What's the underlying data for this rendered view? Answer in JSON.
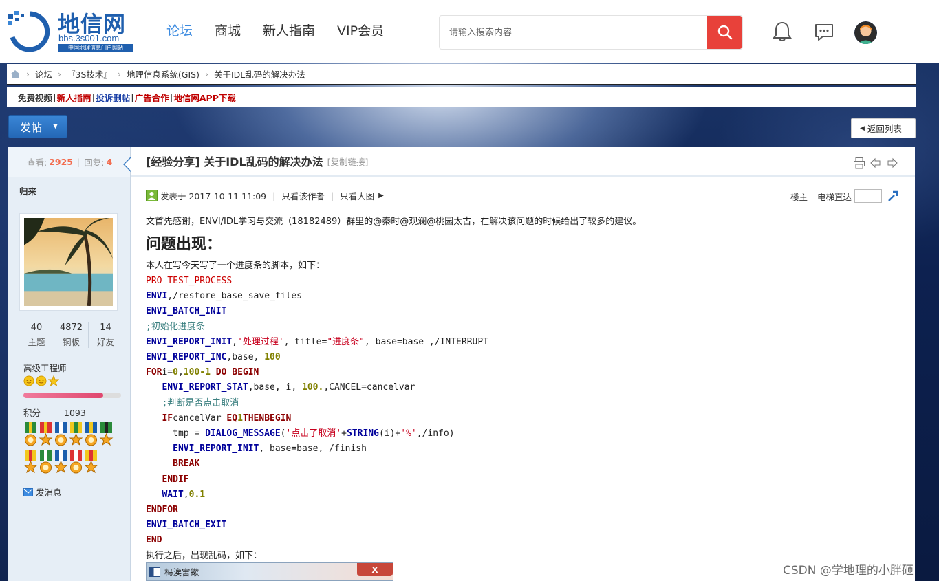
{
  "header": {
    "logo_title": "地信网",
    "logo_url": "bbs.3s001.com",
    "logo_sub": "中国地理信息门户网站",
    "nav": [
      "论坛",
      "商城",
      "新人指南",
      "VIP会员"
    ],
    "active_nav": "论坛",
    "search_placeholder": "请输入搜索内容"
  },
  "breadcrumb": [
    "论坛",
    "『3S技术』",
    "地理信息系统(GIS)",
    "关于IDL乱码的解决办法"
  ],
  "sub_links": [
    {
      "label": "免费视频",
      "color": "#333333"
    },
    {
      "label": "新人指南",
      "color": "#c00000"
    },
    {
      "label": "投诉删帖",
      "color": "#1a3fa6"
    },
    {
      "label": "广告合作",
      "color": "#c00000"
    },
    {
      "label": "地信网APP下载",
      "color": "#c00000"
    }
  ],
  "post_button": "发帖",
  "back_button": "返回列表",
  "sidebar": {
    "views_label": "查看:",
    "views": "2925",
    "replies_label": "回复:",
    "replies": "4",
    "username": "归来",
    "counts": [
      {
        "value": "40",
        "label": "主题"
      },
      {
        "value": "4872",
        "label": "铜板"
      },
      {
        "value": "14",
        "label": "好友"
      }
    ],
    "rank": "高级工程师",
    "level_progress": 0.82,
    "points_label": "积分",
    "points": "1093",
    "send_message": "发消息"
  },
  "post": {
    "category": "[经验分享]",
    "title": "关于IDL乱码的解决办法",
    "copy_link": "[复制链接]",
    "posted_at": "发表于 2017-10-11 11:09",
    "only_author": "只看该作者",
    "large_image": "只看大图",
    "floor": "楼主",
    "elevator": "电梯直达",
    "intro": "文首先感谢，ENVI/IDL学习与交流（18182489）群里的@秦时@观澜@桃园太古，在解决该问题的时候给出了较多的建议。",
    "heading": "问题出现：",
    "para1": "本人在写今天写了一个进度条的脚本，如下：",
    "para2": "执行之后，出现乱码，如下：",
    "error_window_title": "杩涘害鏉",
    "error_close": "X"
  },
  "code_lines": [
    [
      [
        "red",
        "PRO TEST_PROCESS"
      ]
    ],
    [
      [
        "kw",
        "ENVI"
      ],
      [
        "plain",
        ",/restore_base_save_files"
      ]
    ],
    [
      [
        "kw",
        "ENVI_BATCH_INIT"
      ]
    ],
    [
      [
        "cmt",
        ";初始化进度条"
      ]
    ],
    [
      [
        "kw",
        "ENVI_REPORT_INIT"
      ],
      [
        "plain",
        ","
      ],
      [
        "str",
        "'处理过程'"
      ],
      [
        "plain",
        ", title="
      ],
      [
        "str",
        "\"进度条\""
      ],
      [
        "plain",
        ", base=base ,/INTERRUPT"
      ]
    ],
    [
      [
        "kw",
        "ENVI_REPORT_INC"
      ],
      [
        "plain",
        ",base, "
      ],
      [
        "num",
        "100"
      ]
    ],
    [
      [
        "kwr",
        "FOR"
      ],
      [
        "plain",
        "i="
      ],
      [
        "num",
        "0"
      ],
      [
        "plain",
        ","
      ],
      [
        "num",
        "100-1"
      ],
      [
        "plain",
        " "
      ],
      [
        "kwr",
        "DO BEGIN"
      ]
    ],
    [
      [
        "plain",
        "   "
      ],
      [
        "kw",
        "ENVI_REPORT_STAT"
      ],
      [
        "plain",
        ",base, i, "
      ],
      [
        "num",
        "100."
      ],
      [
        "plain",
        ",CANCEL=cancelvar"
      ]
    ],
    [
      [
        "plain",
        "   "
      ],
      [
        "cmt",
        ";判断是否点击取消"
      ]
    ],
    [
      [
        "plain",
        "   "
      ],
      [
        "kwr",
        "IF"
      ],
      [
        "plain",
        "cancelVar "
      ],
      [
        "kwr",
        "EQ"
      ],
      [
        "num",
        "1"
      ],
      [
        "kwr",
        "THENBEGIN"
      ]
    ],
    [
      [
        "plain",
        "     tmp = "
      ],
      [
        "kw",
        "DIALOG_MESSAGE"
      ],
      [
        "plain",
        "("
      ],
      [
        "str",
        "'点击了取消'"
      ],
      [
        "plain",
        "+"
      ],
      [
        "kw",
        "STRING"
      ],
      [
        "plain",
        "(i)+"
      ],
      [
        "str",
        "'%'"
      ],
      [
        "plain",
        ",/info)"
      ]
    ],
    [
      [
        "plain",
        "     "
      ],
      [
        "kw",
        "ENVI_REPORT_INIT"
      ],
      [
        "plain",
        ", base=base, /finish"
      ]
    ],
    [
      [
        "plain",
        "     "
      ],
      [
        "kwr",
        "BREAK"
      ]
    ],
    [
      [
        "plain",
        "   "
      ],
      [
        "kwr",
        "ENDIF"
      ]
    ],
    [
      [
        "plain",
        "   "
      ],
      [
        "kw",
        "WAIT"
      ],
      [
        "plain",
        ","
      ],
      [
        "num",
        "0.1"
      ]
    ],
    [
      [
        "kwr",
        "ENDFOR"
      ]
    ],
    [
      [
        "kw",
        "ENVI_BATCH_EXIT"
      ]
    ],
    [
      [
        "kwr",
        "END"
      ]
    ]
  ],
  "watermark": "CSDN @学地理的小胖砸",
  "colors": {
    "accent": "#3c8be0",
    "search_button": "#e8413a",
    "brand": "#1f5fae"
  }
}
